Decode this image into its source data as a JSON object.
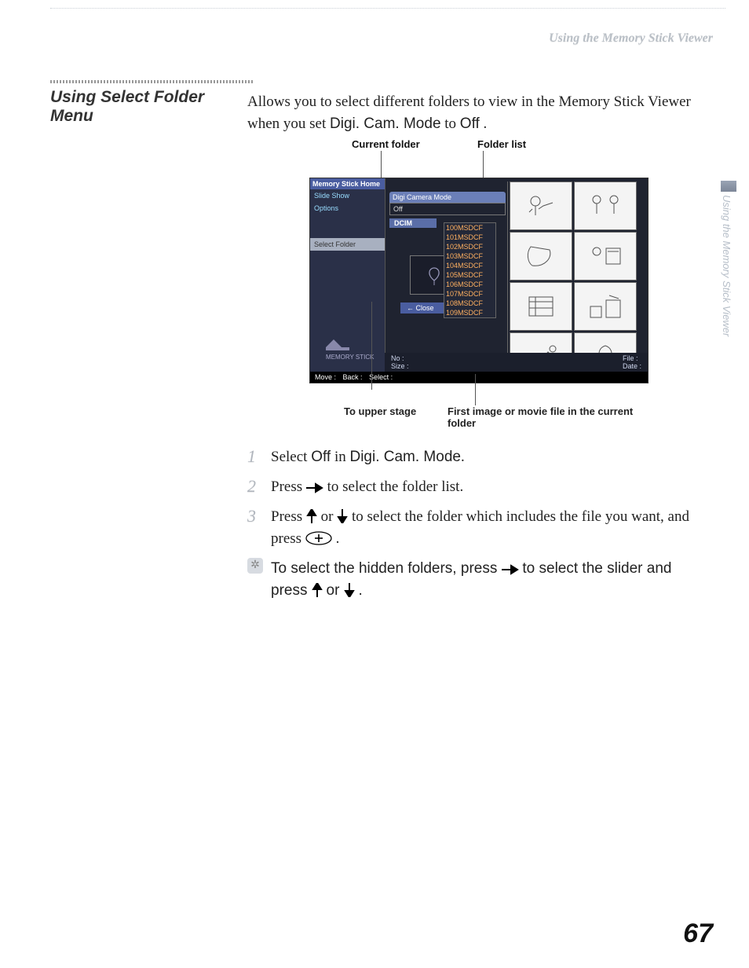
{
  "header": {
    "section": "Using the Memory Stick Viewer"
  },
  "sidebar_tab": "Using the Memory Stick Viewer",
  "title": "Using Select Folder Menu",
  "intro": {
    "part1": "Allows you to select different folders to view in the Memory Stick Viewer when you set ",
    "mode": "Digi. Cam. Mode",
    "part2": " to ",
    "value": "Off",
    "part3": "."
  },
  "callouts": {
    "current_folder": "Current folder",
    "folder_list": "Folder list",
    "to_upper_stage": "To upper stage",
    "first_image": "First image or movie file in the current folder"
  },
  "screenshot": {
    "menu": {
      "home": "Memory Stick Home",
      "slide_show": "Slide Show",
      "options": "Options",
      "select_folder": "Select Folder"
    },
    "mode_label": "Digi Camera Mode",
    "mode_value": "Off",
    "dcim": "DCIM",
    "folders": [
      "100MSDCF",
      "101MSDCF",
      "102MSDCF",
      "103MSDCF",
      "104MSDCF",
      "105MSDCF",
      "106MSDCF",
      "107MSDCF",
      "108MSDCF",
      "109MSDCF"
    ],
    "close": "← Close",
    "info": {
      "no": "No  :",
      "size": "Size :",
      "file": "File  :",
      "date": "Date :"
    },
    "bar": {
      "move": "Move :",
      "back": "Back :",
      "select": "Select :"
    },
    "ms_label": "MEMORY STICK"
  },
  "steps": [
    {
      "a": "Select ",
      "b": "Off",
      "c": " in ",
      "d": "Digi. Cam. Mode",
      "e": "."
    },
    {
      "a": "Press ",
      "b": " to select the folder list."
    },
    {
      "a": "Press ",
      "b": " or ",
      "c": " to select the folder which includes the file you want, and press ",
      "d": "."
    }
  ],
  "tip": {
    "a": "To select the hidden folders, ",
    "b": "press ",
    "c": " to select the ",
    "d": "slider and press ",
    "e": "or ",
    "f": "."
  },
  "page_number": "67"
}
